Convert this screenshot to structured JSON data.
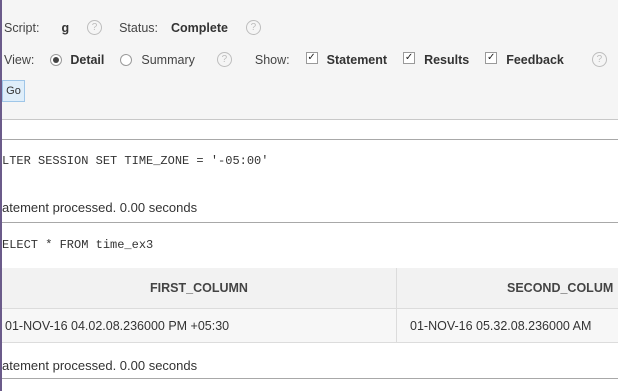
{
  "header": {
    "script_label": "Script:",
    "script_value": "g",
    "status_label": "Status:",
    "status_value": "Complete",
    "view_label": "View:",
    "view_detail": "Detail",
    "view_summary": "Summary",
    "show_label": "Show:",
    "show_statement": "Statement",
    "show_results": "Results",
    "show_feedback": "Feedback",
    "help_glyph": "?",
    "go_label": "Go"
  },
  "output": {
    "stmt1": "LTER SESSION SET TIME_ZONE = '-05:00'",
    "feedback1": "atement processed. 0.00 seconds",
    "stmt2": "ELECT * FROM time_ex3",
    "columns": [
      "FIRST_COLUMN",
      "SECOND_COLUM"
    ],
    "rows": [
      [
        "01-NOV-16 04.02.08.236000 PM +05:30",
        "01-NOV-16 05.32.08.236000 AM"
      ]
    ],
    "feedback2": "atement processed. 0.00 seconds"
  }
}
